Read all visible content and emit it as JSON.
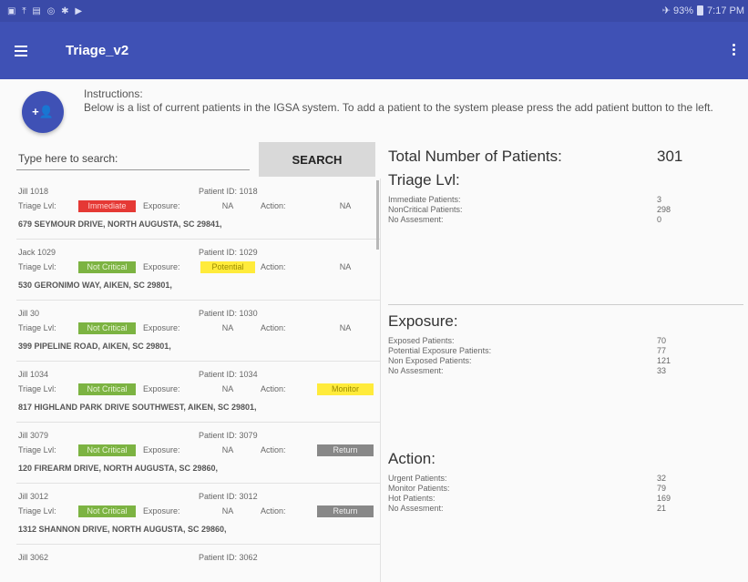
{
  "status_bar": {
    "left_icons": "▣ ⤒ ▤ ◎ ✱ ▶",
    "right_icons": "✈ 93%",
    "time": "7:17 PM"
  },
  "app_bar": {
    "title": "Triage_v2",
    "menu_icon": "menu-icon",
    "overflow_icon": "more-vert-icon"
  },
  "instructions": {
    "heading": "Instructions:",
    "body": "Below is a list of current patients in the IGSA system. To add a patient to the system please press the add patient button to the left.",
    "add_button_icon": "add-person-icon",
    "add_button_glyph": "+👤"
  },
  "search": {
    "placeholder": "Type here to search:",
    "button_label": "SEARCH"
  },
  "card_labels": {
    "patient_id": "Patient ID:",
    "triage": "Triage Lvl:",
    "exposure": "Exposure:",
    "action": "Action:"
  },
  "badge_colors": {
    "Immediate": "#e53935",
    "Not Critical": "#7cb342",
    "Potential": "#ffeb3b",
    "Monitor": "#ffeb3b",
    "Return": "#888888"
  },
  "patients": [
    {
      "name": "Jill 1018",
      "id": "1018",
      "triage": "Immediate",
      "triage_style": "b-red",
      "exposure": "NA",
      "exposure_style": "b-none",
      "action": "NA",
      "action_style": "b-none",
      "address": "679 SEYMOUR DRIVE, NORTH AUGUSTA, SC 29841,"
    },
    {
      "name": "Jack 1029",
      "id": "1029",
      "triage": "Not Critical",
      "triage_style": "b-green",
      "exposure": "Potential",
      "exposure_style": "b-yellow",
      "action": "NA",
      "action_style": "b-none",
      "address": "530 GERONIMO WAY, AIKEN, SC 29801,"
    },
    {
      "name": "Jill 30",
      "id": "1030",
      "triage": "Not Critical",
      "triage_style": "b-green",
      "exposure": "NA",
      "exposure_style": "b-none",
      "action": "NA",
      "action_style": "b-none",
      "address": "399 PIPELINE ROAD, AIKEN, SC 29801,"
    },
    {
      "name": "Jill 1034",
      "id": "1034",
      "triage": "Not Critical",
      "triage_style": "b-green",
      "exposure": "NA",
      "exposure_style": "b-none",
      "action": "Monitor",
      "action_style": "b-yellow",
      "address": "817 HIGHLAND PARK DRIVE SOUTHWEST, AIKEN, SC 29801,"
    },
    {
      "name": "Jill 3079",
      "id": "3079",
      "triage": "Not Critical",
      "triage_style": "b-green",
      "exposure": "NA",
      "exposure_style": "b-none",
      "action": "Return",
      "action_style": "b-gray",
      "address": "120 FIREARM DRIVE, NORTH AUGUSTA, SC 29860,"
    },
    {
      "name": "Jill 3012",
      "id": "3012",
      "triage": "Not Critical",
      "triage_style": "b-green",
      "exposure": "NA",
      "exposure_style": "b-none",
      "action": "Return",
      "action_style": "b-gray",
      "address": "1312 SHANNON DRIVE, NORTH AUGUSTA, SC 29860,"
    },
    {
      "name": "Jill 3062",
      "id": "3062",
      "triage": "",
      "triage_style": "b-none",
      "exposure": "",
      "exposure_style": "b-none",
      "action": "",
      "action_style": "b-none",
      "address": ""
    }
  ],
  "stats": {
    "total_label": "Total Number of Patients:",
    "total_value": "301",
    "triage": {
      "title": "Triage Lvl:",
      "rows": [
        {
          "label": "Immediate Patients:",
          "value": "3"
        },
        {
          "label": "NonCritical Patients:",
          "value": "298"
        },
        {
          "label": "No Assesment:",
          "value": "0"
        }
      ]
    },
    "exposure": {
      "title": "Exposure:",
      "rows": [
        {
          "label": "Exposed Patients:",
          "value": "70"
        },
        {
          "label": "Potential Exposure Patients:",
          "value": "77"
        },
        {
          "label": "Non Exposed Patients:",
          "value": "121"
        },
        {
          "label": "No Assesment:",
          "value": "33"
        }
      ]
    },
    "action": {
      "title": "Action:",
      "rows": [
        {
          "label": "Urgent Patients:",
          "value": "32"
        },
        {
          "label": "Monitor Patients:",
          "value": "79"
        },
        {
          "label": "Hot Patients:",
          "value": "169"
        },
        {
          "label": "No Assesment:",
          "value": "21"
        }
      ]
    }
  }
}
